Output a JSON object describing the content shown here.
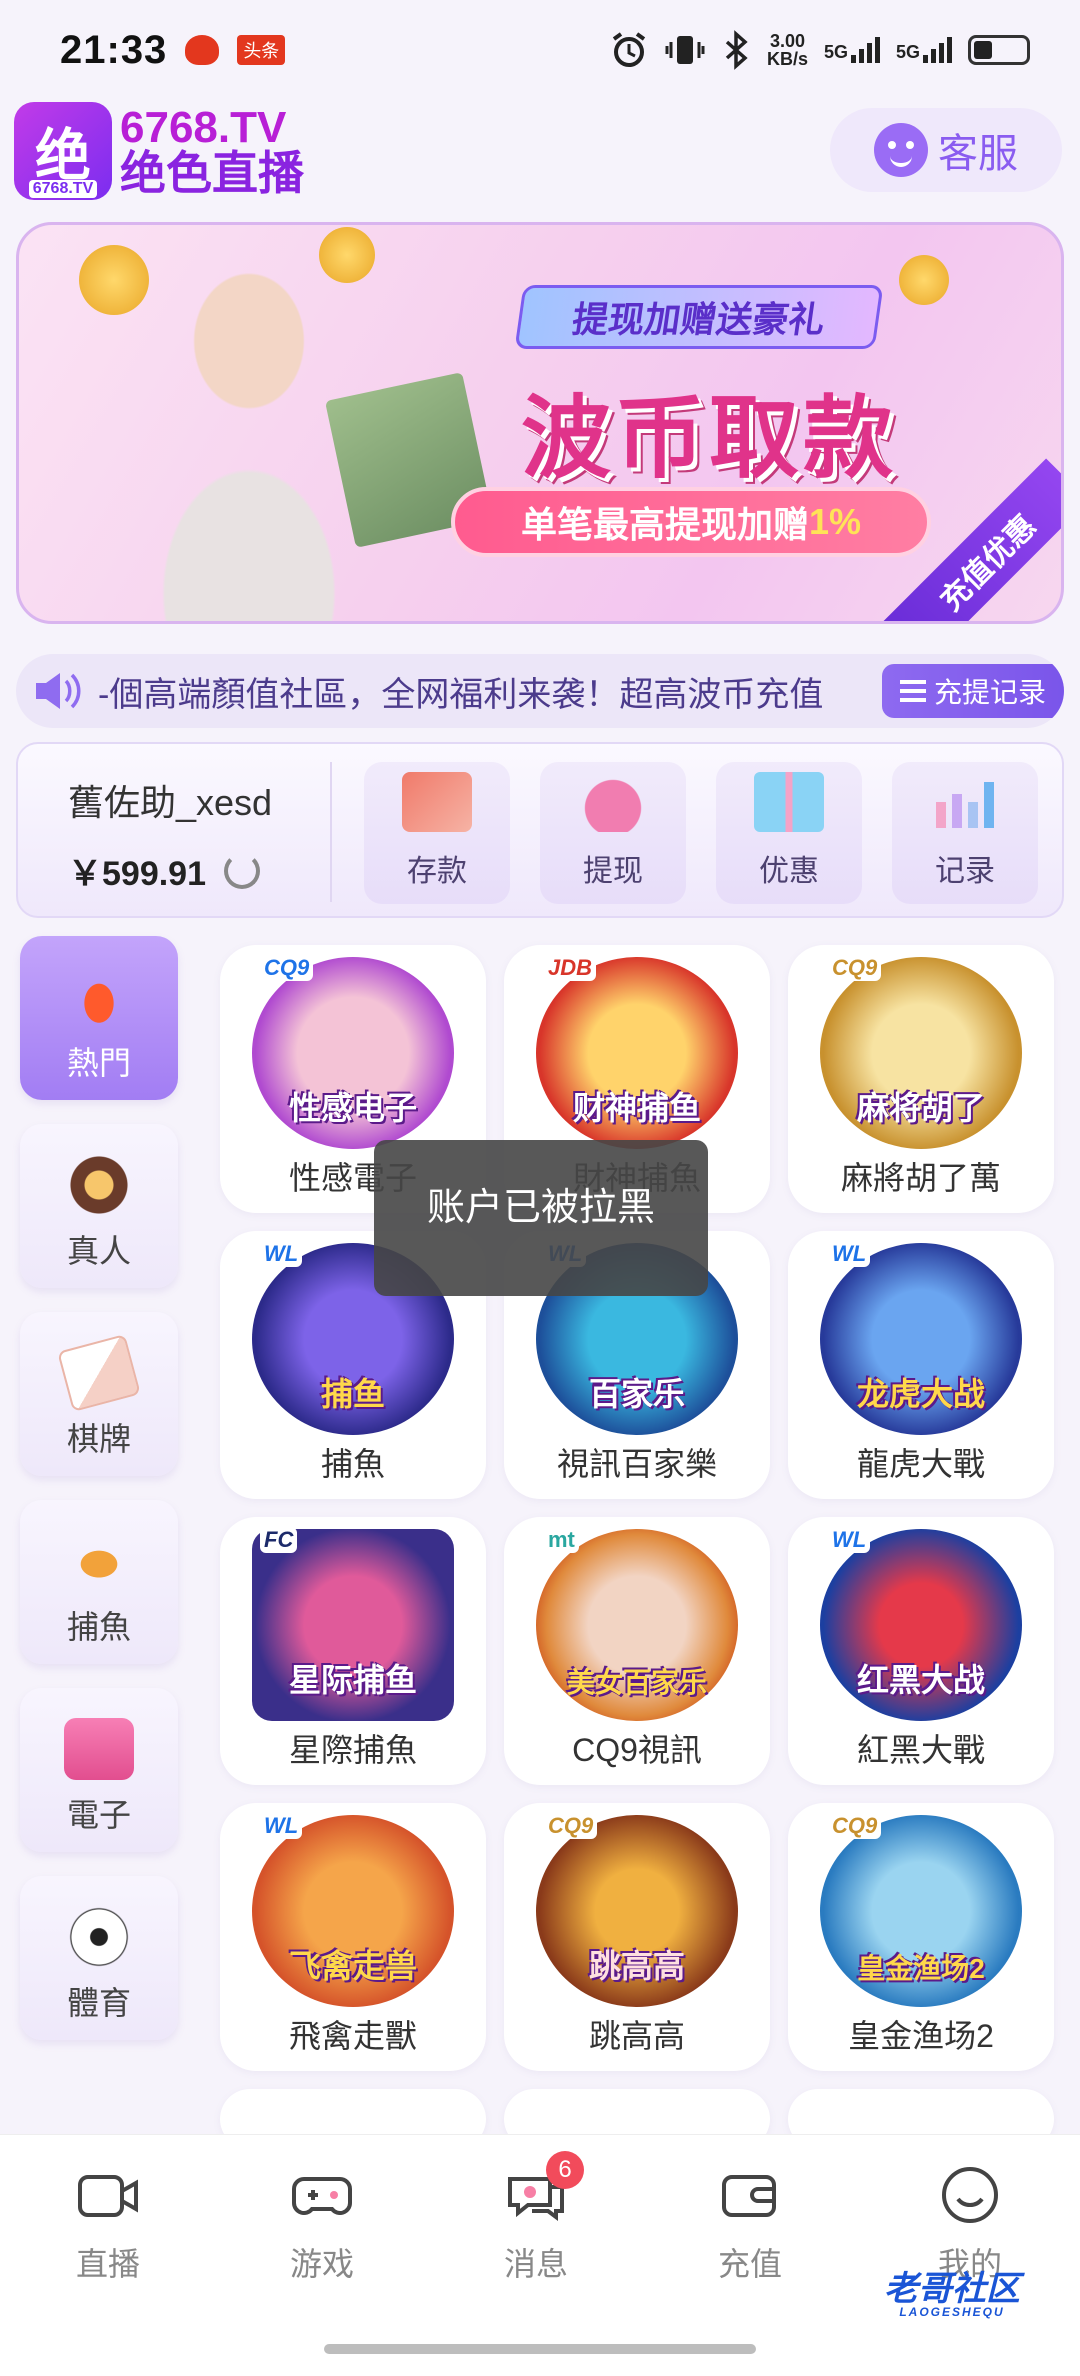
{
  "status_bar": {
    "time": "21:33",
    "badge": "头条",
    "speed_value": "3.00",
    "speed_unit": "KB/s",
    "network1": "5G",
    "network2": "5G"
  },
  "header": {
    "logo_badge_char": "绝",
    "logo_badge_caption": "6768.TV",
    "logo_line1": "6768.TV",
    "logo_line2": "绝色直播",
    "service_label": "客服"
  },
  "banner": {
    "tag": "提现加赠送豪礼",
    "title": "波币取款",
    "sub_prefix": "单笔最高提现加赠",
    "sub_highlight": "1%",
    "corner": "充值优惠"
  },
  "notice": {
    "text": "-個高端顏值社區，全网福利来袭！超高波币充值",
    "record_label": "充提记录"
  },
  "account": {
    "name": "舊佐助_xesd",
    "balance": "￥599.91",
    "actions": [
      {
        "label": "存款",
        "icon": "card-icon"
      },
      {
        "label": "提现",
        "icon": "money-bag-icon"
      },
      {
        "label": "优惠",
        "icon": "gift-icon"
      },
      {
        "label": "记录",
        "icon": "bar-chart-icon"
      }
    ]
  },
  "sidebar": {
    "items": [
      {
        "label": "熱門",
        "icon": "flame-icon"
      },
      {
        "label": "真人",
        "icon": "chip-icon"
      },
      {
        "label": "棋牌",
        "icon": "cards-icon"
      },
      {
        "label": "捕魚",
        "icon": "fish-icon"
      },
      {
        "label": "電子",
        "icon": "slot-icon"
      },
      {
        "label": "體育",
        "icon": "soccer-ball-icon"
      }
    ]
  },
  "games": [
    {
      "name": "性感電子",
      "brand": "CQ9",
      "art_text": "性感电子"
    },
    {
      "name": "財神捕魚",
      "brand": "JDB",
      "art_text": "财神捕鱼"
    },
    {
      "name": "麻將胡了萬",
      "brand": "CQ9",
      "art_text": "麻将胡了"
    },
    {
      "name": "捕魚",
      "brand": "WL",
      "art_text": "捕鱼"
    },
    {
      "name": "視訊百家樂",
      "brand": "WL",
      "art_text": "百家乐"
    },
    {
      "name": "龍虎大戰",
      "brand": "WL",
      "art_text": "龙虎大战"
    },
    {
      "name": "星際捕魚",
      "brand": "FC",
      "art_text": "星际捕鱼"
    },
    {
      "name": "CQ9視訊",
      "brand": "mt",
      "art_text": "美女百家乐"
    },
    {
      "name": "紅黑大戰",
      "brand": "WL",
      "art_text": "红黑大战"
    },
    {
      "name": "飛禽走獸",
      "brand": "WL",
      "art_text": "飞禽走兽"
    },
    {
      "name": "跳高高",
      "brand": "CQ9",
      "art_text": "跳高高"
    },
    {
      "name": "皇金渔场2",
      "brand": "CQ9",
      "art_text": "皇金渔场2"
    }
  ],
  "toast": "账户已被拉黑",
  "tabbar": {
    "tabs": [
      {
        "label": "直播",
        "icon": "camera-icon"
      },
      {
        "label": "游戏",
        "icon": "gamepad-icon"
      },
      {
        "label": "消息",
        "icon": "chat-icon",
        "badge": "6"
      },
      {
        "label": "充值",
        "icon": "wallet-icon"
      },
      {
        "label": "我的",
        "icon": "smile-icon"
      }
    ]
  },
  "watermark": {
    "text": "老哥社区",
    "sub": "LAOGESHEQU"
  },
  "colors": {
    "accent": "#8a5cf0",
    "banner_title": "#e0338a",
    "tab_badge": "#f24b5b"
  }
}
